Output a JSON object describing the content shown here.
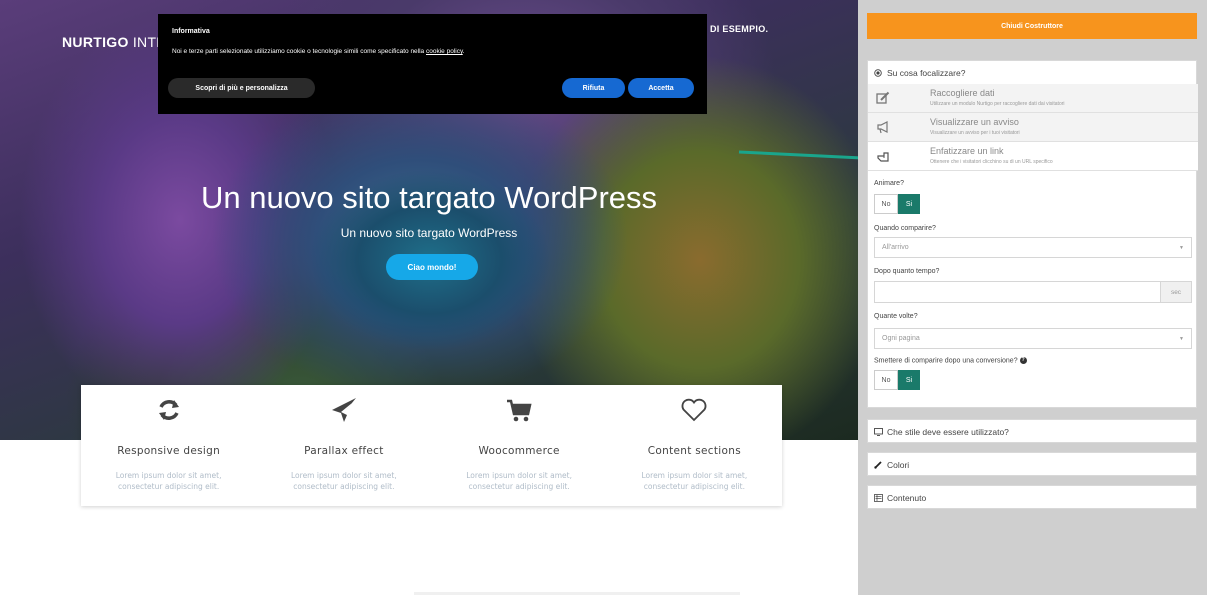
{
  "site": {
    "brand_bold": "NURTIGO",
    "brand_light": "INTEG",
    "nav_right": "DI ESEMPIO.",
    "hero_title": "Un nuovo sito targato WordPress",
    "hero_subtitle": "Un nuovo sito targato WordPress",
    "hero_button": "Ciao mondo!"
  },
  "cookie": {
    "title": "Informativa",
    "text": "Noi e terze parti selezionate utilizziamo cookie o tecnologie simili come specificato nella",
    "link": "cookie policy",
    "text_end": ".",
    "more_button": "Scopri di più e personalizza",
    "reject_button": "Rifiuta",
    "accept_button": "Accetta"
  },
  "features": [
    {
      "icon": "refresh-icon",
      "title": "Responsive design",
      "desc": "Lorem ipsum dolor sit amet, consectetur adipiscing elit."
    },
    {
      "icon": "paper-plane-icon",
      "title": "Parallax effect",
      "desc": "Lorem ipsum dolor sit amet, consectetur adipiscing elit."
    },
    {
      "icon": "cart-icon",
      "title": "Woocommerce",
      "desc": "Lorem ipsum dolor sit amet, consectetur adipiscing elit."
    },
    {
      "icon": "heart-icon",
      "title": "Content sections",
      "desc": "Lorem ipsum dolor sit amet, consectetur adipiscing elit."
    }
  ],
  "sidebar": {
    "close_button": "Chiudi Costruttore",
    "focus_title": "Su cosa focalizzare?",
    "options": [
      {
        "icon": "edit-icon",
        "title": "Raccogliere dati",
        "desc": "Utilizzare un modulo Nurtigo per raccogliere dati dai visitatori"
      },
      {
        "icon": "megaphone-icon",
        "title": "Visualizzare un avviso",
        "desc": "Visualizzare un avviso per i tuoi visitatori"
      },
      {
        "icon": "pointer-hand-icon",
        "title": "Enfatizzare un link",
        "desc": "Ottenere che i visitatori clicchino su di un URL specifico"
      }
    ],
    "animate_label": "Animare?",
    "animate_no": "No",
    "animate_yes": "Si",
    "when_label": "Quando comparire?",
    "when_value": "All'arrivo",
    "delay_label": "Dopo quanto tempo?",
    "delay_value": "",
    "delay_unit": "sec",
    "times_label": "Quante volte?",
    "times_value": "Ogni pagina",
    "stop_label": "Smettere di comparire dopo una conversione?",
    "stop_no": "No",
    "stop_yes": "Si",
    "style_section": "Che stile deve essere utilizzato?",
    "colors_section": "Colori",
    "content_section": "Contenuto"
  },
  "colors": {
    "accent_orange": "#f7941d",
    "toggle_teal": "#1a7a6a",
    "hero_button_blue": "#16a8e8",
    "cookie_button_blue": "#1669d2"
  }
}
